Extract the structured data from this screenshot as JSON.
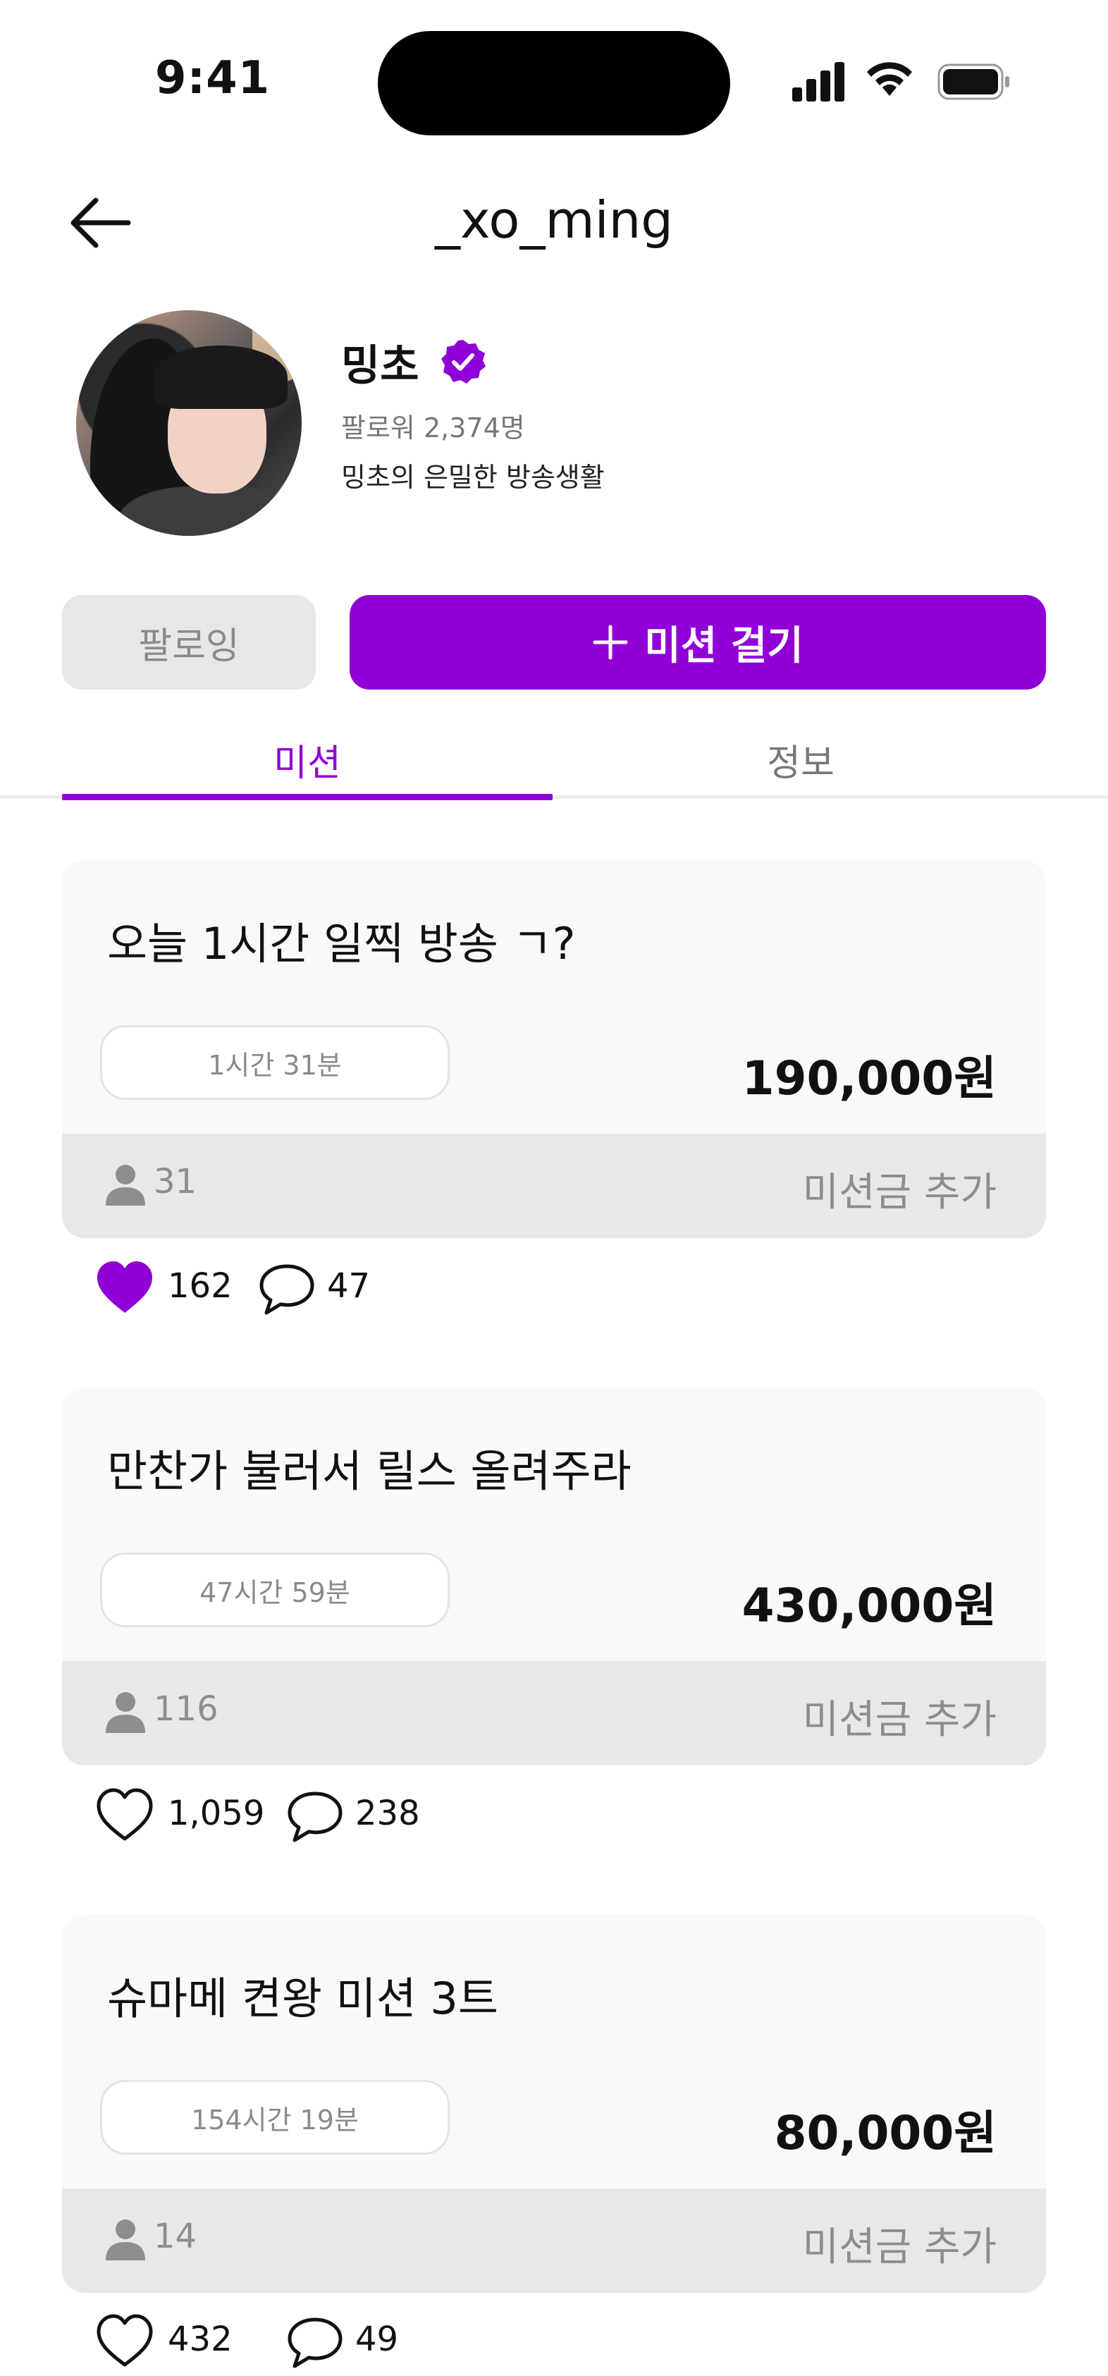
{
  "status": {
    "time": "9:41"
  },
  "header": {
    "title": "_xo_ming"
  },
  "profile": {
    "name": "밍초",
    "followers": "팔로워 2,374명",
    "bio": "밍초의 은밀한 방송생활"
  },
  "actions": {
    "following_label": "팔로잉",
    "mission_label": "미션 걸기"
  },
  "tabs": [
    {
      "label": "미션",
      "active": true
    },
    {
      "label": "정보",
      "active": false
    }
  ],
  "colors": {
    "accent": "#9000d6"
  },
  "missions": [
    {
      "title": "오늘 1시간 일찍 방송 ㄱ?",
      "timer": "1시간 31분",
      "price": "190,000원",
      "participants": "31",
      "add_label": "미션금 추가",
      "likes": "162",
      "liked": true,
      "comments": "47"
    },
    {
      "title": "만찬가 불러서 릴스 올려주라",
      "timer": "47시간 59분",
      "price": "430,000원",
      "participants": "116",
      "add_label": "미션금 추가",
      "likes": "1,059",
      "liked": false,
      "comments": "238"
    },
    {
      "title": "슈마메 켠왕 미션 3트",
      "timer": "154시간 19분",
      "price": "80,000원",
      "participants": "14",
      "add_label": "미션금 추가",
      "likes": "432",
      "liked": false,
      "comments": "49"
    }
  ]
}
